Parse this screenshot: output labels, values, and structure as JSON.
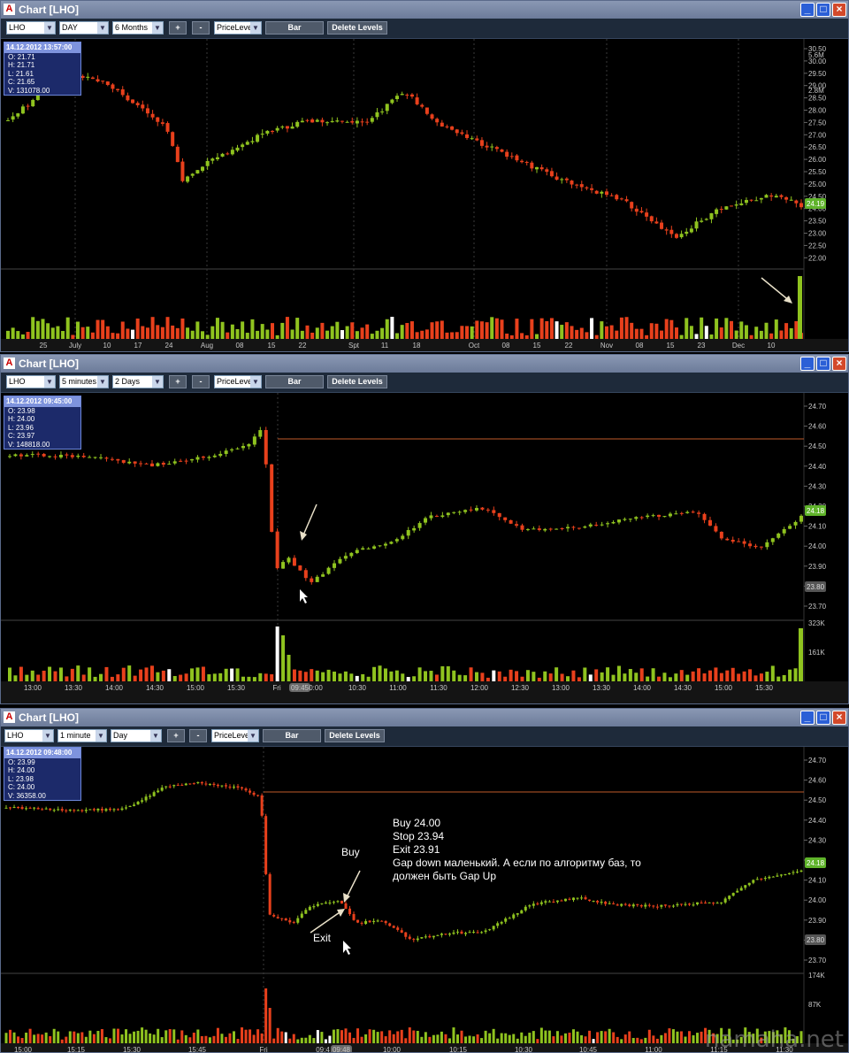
{
  "colors": {
    "up": "#8fc31f",
    "down": "#e8401c",
    "bg": "#000000",
    "grid": "#1a1a1a",
    "level": "#c05a2a",
    "axis": "#c8c8c8"
  },
  "windows": [
    {
      "title": "Chart [LHO]",
      "symbol": "LHO",
      "period": "DAY",
      "range": "6 Months",
      "plus": "+",
      "minus": "-",
      "pricelevel": "PriceLeve",
      "bar_button": "Bar",
      "delete_levels": "Delete Levels",
      "info": {
        "datetime": "14.12.2012 13:57:00",
        "o": "O: 21.71",
        "h": "H: 21.71",
        "l": "L: 21.61",
        "c": "C: 21.65",
        "v": "V: 131078.00"
      },
      "price_ticks": [
        "30.50",
        "30.00",
        "29.50",
        "29.00",
        "28.50",
        "28.00",
        "27.50",
        "27.00",
        "26.50",
        "26.00",
        "25.50",
        "25.00",
        "24.50",
        "24.00",
        "23.50",
        "23.00",
        "22.50",
        "22.00"
      ],
      "last_price": "24.19",
      "volume_ticks": [
        "5.6M",
        "2.8M"
      ],
      "x_labels": [
        "25",
        "July",
        "10",
        "17",
        "24",
        "Aug",
        "08",
        "15",
        "22",
        "Spt",
        "11",
        "18",
        "Oct",
        "08",
        "15",
        "22",
        "Nov",
        "08",
        "15",
        "23",
        "Dec",
        "10"
      ]
    },
    {
      "title": "Chart [LHO]",
      "symbol": "LHO",
      "period": "5 minutes",
      "range": "2 Days",
      "plus": "+",
      "minus": "-",
      "pricelevel": "PriceLeve",
      "bar_button": "Bar",
      "delete_levels": "Delete Levels",
      "info": {
        "datetime": "14.12.2012 09:45:00",
        "o": "O: 23.98",
        "h": "H: 24.00",
        "l": "L: 23.96",
        "c": "C: 23.97",
        "v": "V: 148818.00"
      },
      "price_ticks": [
        "24.70",
        "24.60",
        "24.50",
        "24.40",
        "24.30",
        "24.20",
        "24.10",
        "24.00",
        "23.90",
        "23.80",
        "23.70"
      ],
      "last_price": "24.18",
      "cursor_price": "23.80",
      "volume_ticks": [
        "323K",
        "161K"
      ],
      "x_labels": [
        "13:00",
        "13:30",
        "14:00",
        "14:30",
        "15:00",
        "15:30",
        "Fri",
        "09:45",
        "0:00",
        "10:30",
        "11:00",
        "11:30",
        "12:00",
        "12:30",
        "13:00",
        "13:30",
        "14:00",
        "14:30",
        "15:00",
        "15:30"
      ]
    },
    {
      "title": "Chart [LHO]",
      "symbol": "LHO",
      "period": "1 minute",
      "range": "Day",
      "plus": "+",
      "minus": "-",
      "pricelevel": "PriceLeve",
      "bar_button": "Bar",
      "delete_levels": "Delete Levels",
      "info": {
        "datetime": "14.12.2012 09:48:00",
        "o": "O: 23.99",
        "h": "H: 24.00",
        "l": "L: 23.98",
        "c": "C: 24.00",
        "v": "V: 36358.00"
      },
      "price_ticks": [
        "24.70",
        "24.60",
        "24.50",
        "24.40",
        "24.30",
        "24.20",
        "24.10",
        "24.00",
        "23.90",
        "23.80",
        "23.70"
      ],
      "last_price": "24.18",
      "cursor_price": "23.80",
      "volume_ticks": [
        "174K",
        "87K"
      ],
      "x_labels": [
        "15:00",
        "15:15",
        "15:30",
        "15:45",
        "Fri",
        "09:4",
        "09:48",
        "10:00",
        "10:15",
        "10:30",
        "10:45",
        "11:00",
        "11:15",
        "11:30"
      ],
      "annotations": {
        "buy_label": "Buy",
        "exit_label": "Exit",
        "note_lines": [
          "Buy 24.00",
          "Stop 23.94",
          "Exit 23.91",
          "Gap down маленький. А если по алгоритму баз, то",
          "должен быть Gap Up"
        ]
      }
    }
  ],
  "watermark": "namaha.net"
}
